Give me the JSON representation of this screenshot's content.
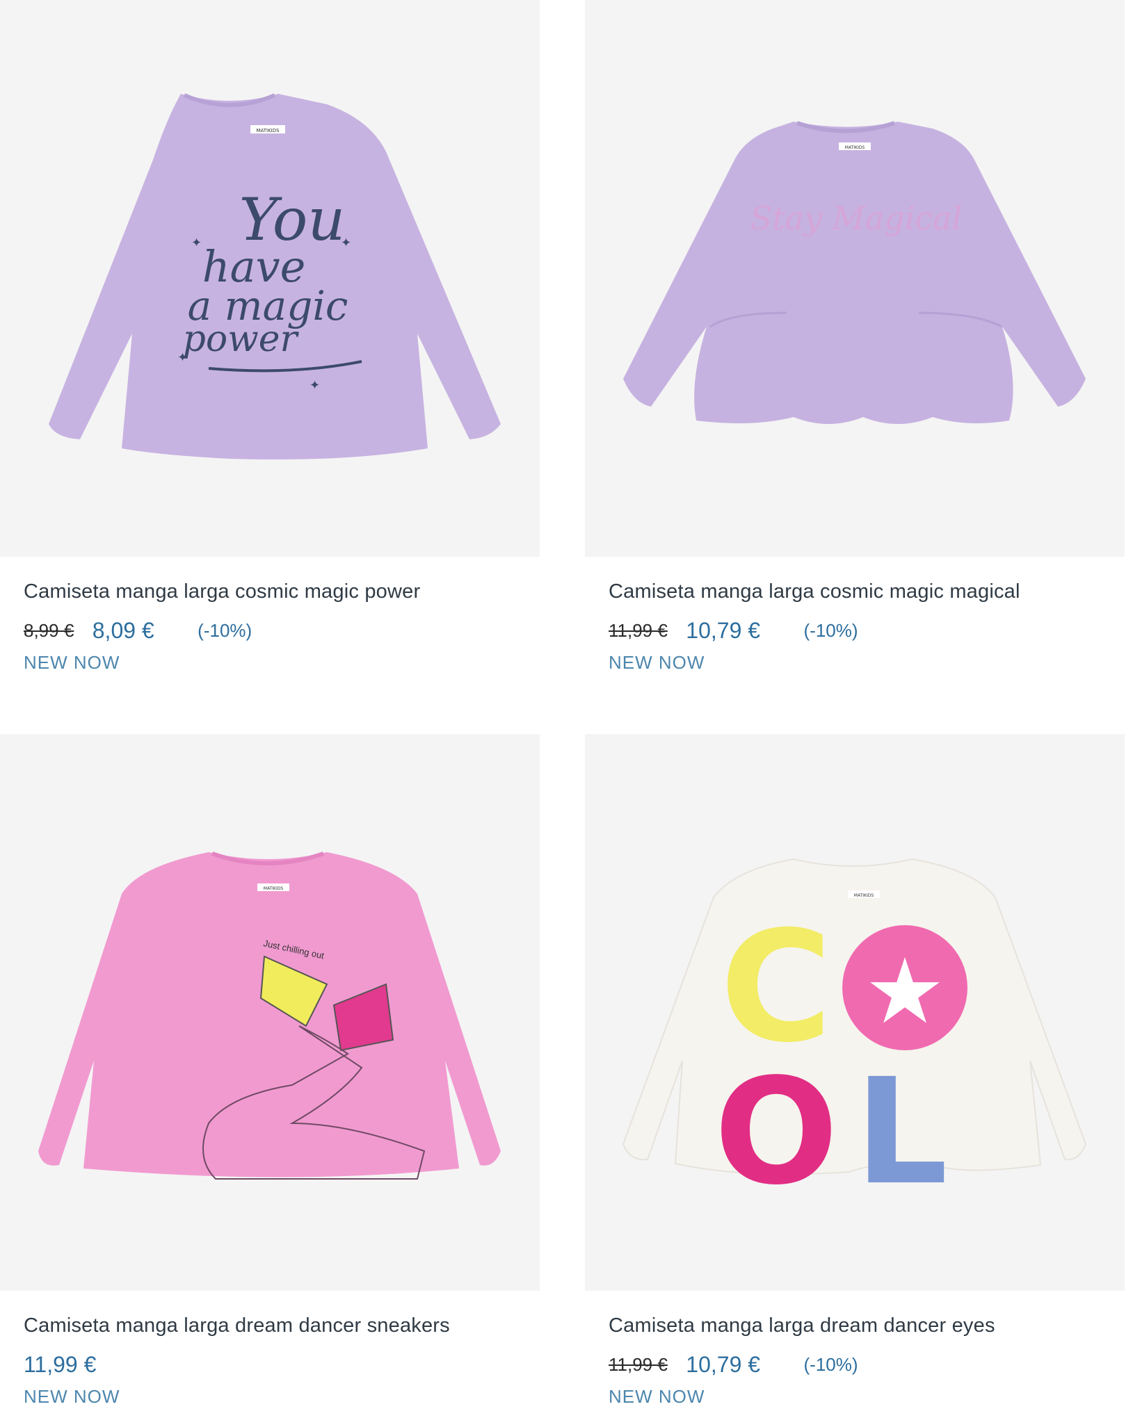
{
  "products": [
    {
      "name": "Camiseta manga larga cosmic magic power",
      "old_price": "8,99 €",
      "price": "8,09 €",
      "discount": "(-10%)",
      "tag": "NEW NOW",
      "print_text": [
        "You",
        "have",
        "a magic",
        "power"
      ],
      "garment_color": "#c7b3e1"
    },
    {
      "name": "Camiseta manga larga cosmic magic magical",
      "old_price": "11,99 €",
      "price": "10,79 €",
      "discount": "(-10%)",
      "tag": "NEW NOW",
      "print_text": [
        "Stay Magical"
      ],
      "garment_color": "#c6b2e0"
    },
    {
      "name": "Camiseta manga larga dream dancer sneakers",
      "price": "11,99 €",
      "tag": "NEW NOW",
      "print_text": [
        "Just chilling out"
      ],
      "garment_color": "#f19ad0"
    },
    {
      "name": "Camiseta manga larga dream dancer eyes",
      "old_price": "11,99 €",
      "price": "10,79 €",
      "discount": "(-10%)",
      "tag": "NEW NOW",
      "print_text": [
        "C",
        "O",
        "O",
        "L"
      ],
      "garment_color": "#f6f4ee"
    }
  ],
  "brand_label": "MATIKIDS"
}
